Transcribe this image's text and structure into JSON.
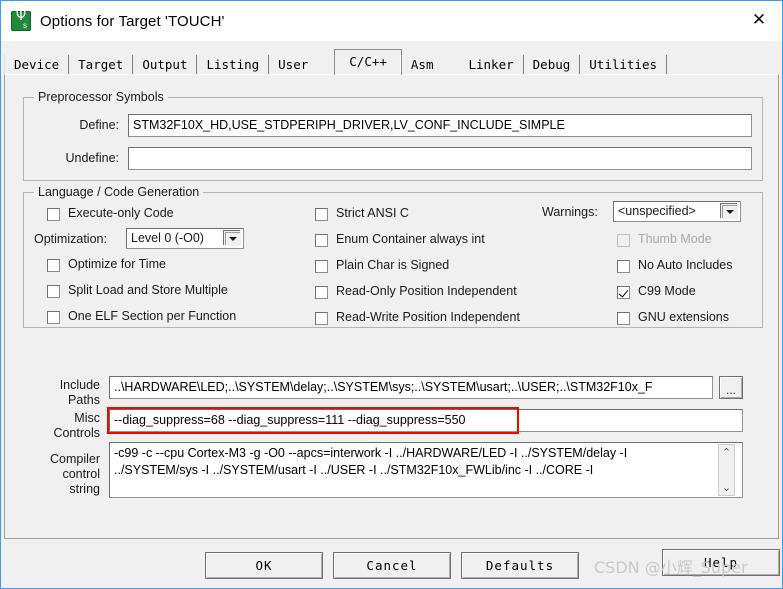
{
  "window": {
    "title": "Options for Target 'TOUCH'",
    "app_icon": "uvision-icon",
    "close_label": "✕"
  },
  "tabs": [
    {
      "label": "Device",
      "active": false
    },
    {
      "label": "Target",
      "active": false
    },
    {
      "label": "Output",
      "active": false
    },
    {
      "label": "Listing",
      "active": false
    },
    {
      "label": "User",
      "active": false
    },
    {
      "label": "C/C++",
      "active": true
    },
    {
      "label": "Asm",
      "active": false
    },
    {
      "label": "Linker",
      "active": false
    },
    {
      "label": "Debug",
      "active": false
    },
    {
      "label": "Utilities",
      "active": false
    }
  ],
  "preprocessor": {
    "legend": "Preprocessor Symbols",
    "define_label": "Define:",
    "define_value": "STM32F10X_HD,USE_STDPERIPH_DRIVER,LV_CONF_INCLUDE_SIMPLE",
    "undefine_label": "Undefine:",
    "undefine_value": ""
  },
  "language": {
    "legend": "Language / Code Generation",
    "col1": [
      {
        "label": "Execute-only Code",
        "checked": false,
        "disabled": false
      },
      {
        "label": "Optimize for Time",
        "checked": false,
        "disabled": false
      },
      {
        "label": "Split Load and Store Multiple",
        "checked": false,
        "disabled": false
      },
      {
        "label": "One ELF Section per Function",
        "checked": false,
        "disabled": false
      }
    ],
    "optimization_label": "Optimization:",
    "optimization_value": "Level 0 (-O0)",
    "col2": [
      {
        "label": "Strict ANSI C",
        "checked": false,
        "disabled": false
      },
      {
        "label": "Enum Container always int",
        "checked": false,
        "disabled": false
      },
      {
        "label": "Plain Char is Signed",
        "checked": false,
        "disabled": false
      },
      {
        "label": "Read-Only Position Independent",
        "checked": false,
        "disabled": false
      },
      {
        "label": "Read-Write Position Independent",
        "checked": false,
        "disabled": false
      }
    ],
    "warnings_label": "Warnings:",
    "warnings_value": "<unspecified>",
    "col3": [
      {
        "label": "Thumb Mode",
        "checked": false,
        "disabled": true
      },
      {
        "label": "No Auto Includes",
        "checked": false,
        "disabled": false
      },
      {
        "label": "C99 Mode",
        "checked": true,
        "disabled": false
      },
      {
        "label": "GNU extensions",
        "checked": false,
        "disabled": false
      }
    ]
  },
  "paths": {
    "include_label_line1": "Include",
    "include_label_line2": "Paths",
    "include_value": "..\\HARDWARE\\LED;..\\SYSTEM\\delay;..\\SYSTEM\\sys;..\\SYSTEM\\usart;..\\USER;..\\STM32F10x_F",
    "browse_label": "...",
    "misc_label_line1": "Misc",
    "misc_label_line2": "Controls",
    "misc_value": "--diag_suppress=68 --diag_suppress=111 --diag_suppress=550",
    "misc_highlight_color": "#ff0000"
  },
  "compiler": {
    "label_line1": "Compiler",
    "label_line2": "control",
    "label_line3": "string",
    "line1": "-c99 -c --cpu Cortex-M3 -g -O0 --apcs=interwork -I ../HARDWARE/LED -I ../SYSTEM/delay -I",
    "line2": "../SYSTEM/sys -I ../SYSTEM/usart -I ../USER -I ../STM32F10x_FWLib/inc -I ../CORE -I",
    "scroll_up": "⌃",
    "scroll_down": "⌄"
  },
  "buttons": {
    "ok": "OK",
    "cancel": "Cancel",
    "defaults": "Defaults",
    "help": "Help"
  },
  "watermark": "CSDN @小辉_Super"
}
